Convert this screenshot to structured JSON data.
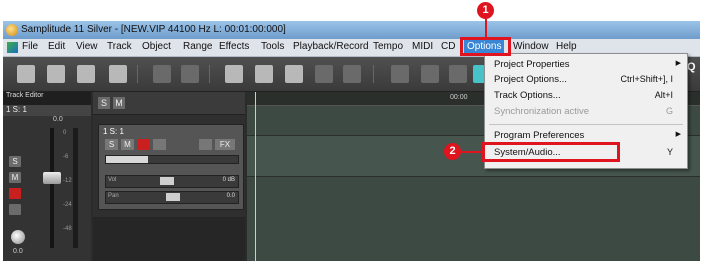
{
  "window": {
    "title": "Samplitude 11 Silver - [NEW.VIP  44100 Hz L: 00:01:00:000]"
  },
  "menubar": {
    "items": [
      {
        "label": "File"
      },
      {
        "label": "Edit"
      },
      {
        "label": "View"
      },
      {
        "label": "Track"
      },
      {
        "label": "Object"
      },
      {
        "label": "Range"
      },
      {
        "label": "Effects"
      },
      {
        "label": "Tools"
      },
      {
        "label": "Playback/Record"
      },
      {
        "label": "Tempo"
      },
      {
        "label": "MIDI"
      },
      {
        "label": "CD"
      },
      {
        "label": "Options"
      },
      {
        "label": "Window"
      },
      {
        "label": "Help"
      }
    ],
    "selected": "Options"
  },
  "toolbar": {
    "q_label": "Q"
  },
  "left_panel": {
    "header": "Track Editor",
    "track_label": "1  S: 1",
    "buttons": [
      "S",
      "M"
    ],
    "level": "0.0",
    "knob_value": "0.0",
    "scale_labels": [
      "0",
      "-6",
      "-12",
      "-24",
      "-48"
    ]
  },
  "mid_panel": {
    "sm_buttons": [
      "S",
      "M"
    ],
    "track_name": "1  S: 1",
    "track_buttons": [
      "S",
      "M",
      "FX"
    ],
    "vol_label": "Vol",
    "vol_value": "0 dB",
    "pan_label": "Pan",
    "pan_value": "0.0"
  },
  "arrange": {
    "timecode": "00:00"
  },
  "options_menu": {
    "items": [
      {
        "label": "Project Properties",
        "shortcut": "",
        "submenu": true,
        "disabled": false
      },
      {
        "label": "Project Options...",
        "shortcut": "Ctrl+Shift+], I",
        "submenu": false,
        "disabled": false
      },
      {
        "label": "Track Options...",
        "shortcut": "Alt+I",
        "submenu": false,
        "disabled": false
      },
      {
        "label": "Synchronization active",
        "shortcut": "G",
        "submenu": false,
        "disabled": true
      },
      {
        "label": "Program Preferences",
        "shortcut": "",
        "submenu": true,
        "disabled": false
      },
      {
        "label": "System/Audio...",
        "shortcut": "Y",
        "submenu": false,
        "disabled": false
      }
    ]
  },
  "annotations": {
    "step1": "1",
    "step2": "2"
  },
  "colors": {
    "highlight_red": "#e0141e",
    "menu_selected": "#3a86d6"
  }
}
